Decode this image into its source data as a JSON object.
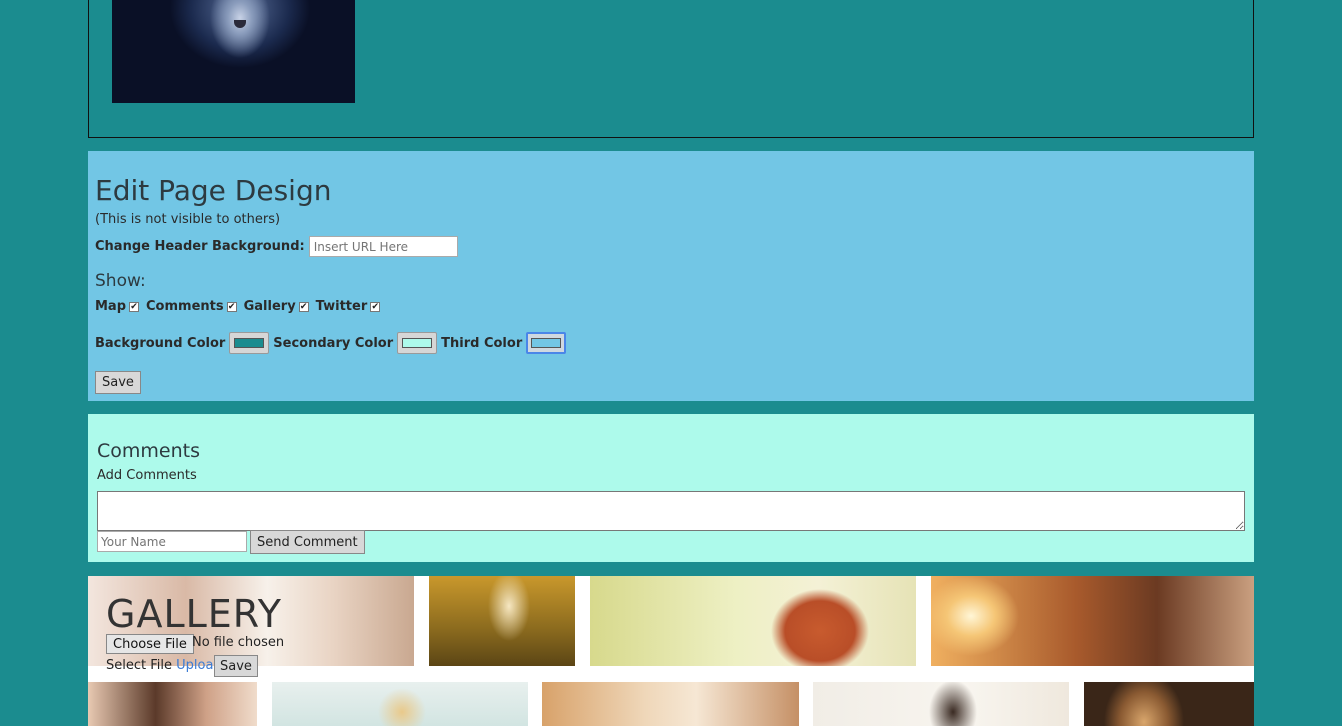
{
  "design": {
    "title": "Edit Page Design",
    "note": "(This is not visible to others)",
    "header_bg_label": "Change Header Background:",
    "header_bg_placeholder": "Insert URL Here",
    "show_label": "Show:",
    "toggles": [
      {
        "label": "Map",
        "checked": true
      },
      {
        "label": "Comments",
        "checked": true
      },
      {
        "label": "Gallery",
        "checked": true
      },
      {
        "label": "Twitter",
        "checked": true
      }
    ],
    "colors": [
      {
        "label": "Background Color",
        "value": "#1b8c8f"
      },
      {
        "label": "Secondary Color",
        "value": "#adfaeb"
      },
      {
        "label": "Third Color",
        "value": "#72c6e5"
      }
    ],
    "save_label": "Save"
  },
  "comments": {
    "title": "Comments",
    "add_label": "Add Comments",
    "name_placeholder": "Your Name",
    "send_label": "Send Comment"
  },
  "gallery": {
    "title": "GALLERY",
    "choose_file_label": "Choose File",
    "no_file_text": "No file chosen",
    "select_file_label": "Select File",
    "upload_label": "Upload",
    "save_label": "Save"
  },
  "theme": {
    "background": "#1b8c8f",
    "panel_blue": "#72c6e5",
    "panel_mint": "#adfaeb"
  }
}
